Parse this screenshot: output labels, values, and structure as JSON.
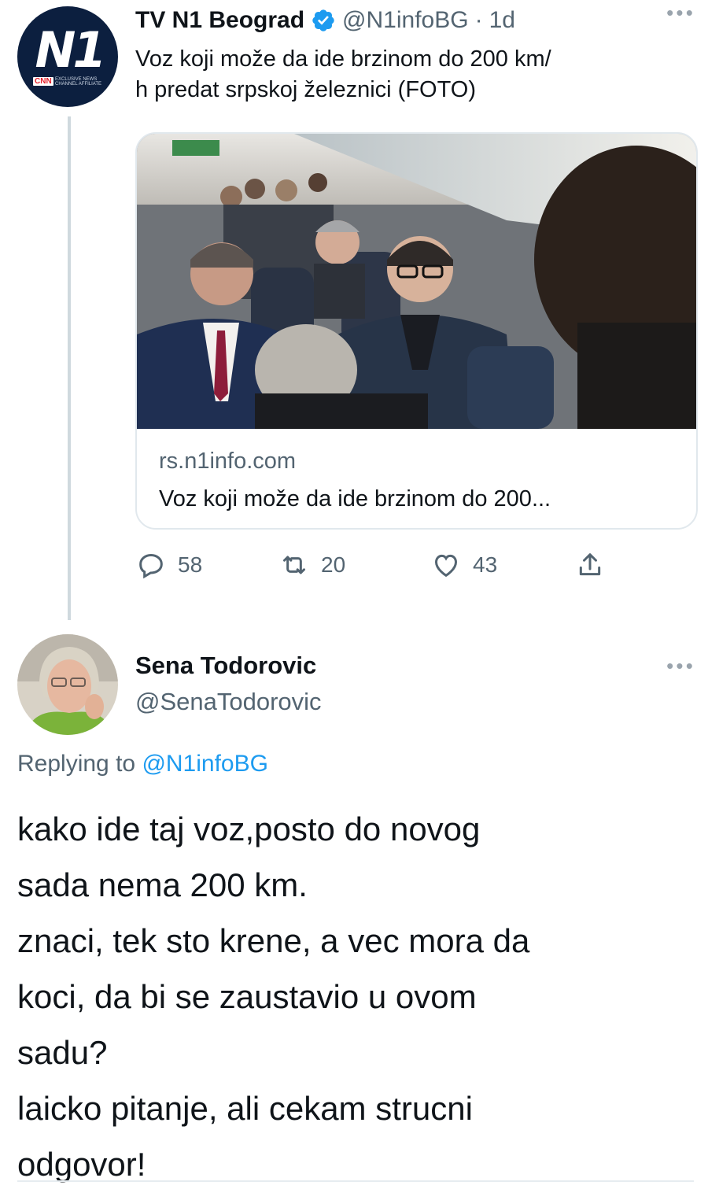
{
  "tweet": {
    "author_name": "TV N1 Beograd",
    "author_handle": "@N1infoBG",
    "separator": "·",
    "time": "1d",
    "avatar_text": "N1",
    "avatar_badge": "CNN",
    "avatar_badge_sub": "EXCLUSIVE NEWS CHANNEL AFFILIATE",
    "text_lines": [
      "Voz koji može da ide brzinom do 200 km/",
      "h predat srpskoj železnici (FOTO)"
    ],
    "card": {
      "domain": "rs.n1info.com",
      "title": "Voz koji može da ide brzinom do 200..."
    },
    "actions": {
      "replies": "58",
      "retweets": "20",
      "likes": "43"
    },
    "icons": [
      "verified-icon",
      "more-icon",
      "reply-icon",
      "retweet-icon",
      "like-icon",
      "share-icon"
    ]
  },
  "reply": {
    "author_name": "Sena Todorovic",
    "author_handle": "@SenaTodorovic",
    "replying_prefix": "Replying to",
    "replying_mention": "@N1infoBG",
    "text_lines": [
      "kako ide taj voz,posto do novog",
      "sada nema 200 km.",
      "znaci, tek sto krene, a vec mora da",
      "koci, da bi se zaustavio u ovom",
      "sadu?",
      "laicko pitanje, ali cekam strucni",
      "odgovor!"
    ]
  },
  "colors": {
    "text": "#0f1419",
    "secondary": "#536471",
    "accent": "#1d9bf0",
    "border": "#e1e8ed"
  }
}
